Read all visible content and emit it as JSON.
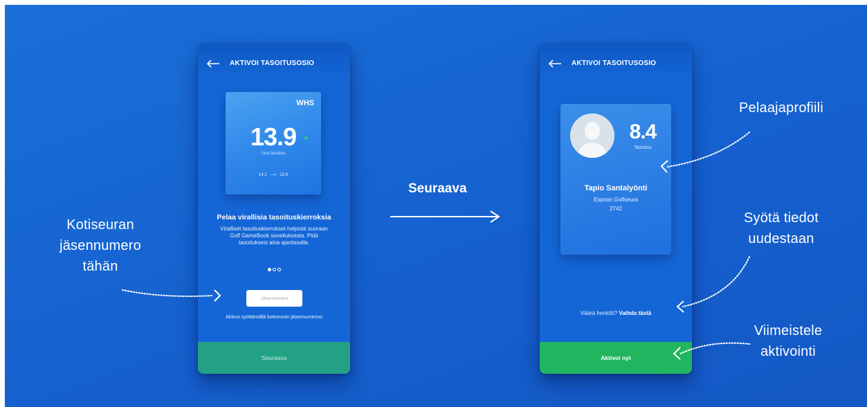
{
  "left_screen": {
    "header_title": "AKTIVOI TASOITUSOSIO",
    "whs_card": {
      "label": "WHS",
      "value": "13.9",
      "sub_label": "Uusi tasoitus",
      "change_from": "14.2",
      "change_to": "13.9"
    },
    "heading": "Pelaa virallisia tasoituskierroksia",
    "body": "Viralliset tasoituskierrokset helposti suoraan Golf GameBook sovelluksesta. Pidä tasoituksesi aina ajantasalla.",
    "pager": {
      "count": 3,
      "active": 1
    },
    "member_input_placeholder": "Jäsennumero",
    "member_hint": "Aktivoi syöttämällä kotiseuran jäsennumerosi",
    "next_button": "Seuraava"
  },
  "right_screen": {
    "header_title": "AKTIVOI TASOITUSOSIO",
    "profile": {
      "handicap": "8.4",
      "handicap_label": "Tasoitus",
      "name": "Tapio Santalyönti",
      "club": "Espoon Golfseura",
      "member_number": "2742"
    },
    "wrong_person_text": "Väärä henkilö?",
    "wrong_person_link": "Vaihda tästä",
    "activate_button": "Aktivoi nyt"
  },
  "annotations": {
    "member_number_line1": "Kotiseuran",
    "member_number_line2": "jäsennumero",
    "member_number_line3": "tähän",
    "next_label": "Seuraava",
    "player_profile": "Pelaajaprofiili",
    "reenter_line1": "Syötä tiedot",
    "reenter_line2": "uudestaan",
    "finish_line1": "Viimeistele",
    "finish_line2": "aktivointi"
  },
  "colors": {
    "background": "#1565d2",
    "next_button": "#23a184",
    "activate_button": "#22b55f",
    "card": "#2e86ea"
  }
}
